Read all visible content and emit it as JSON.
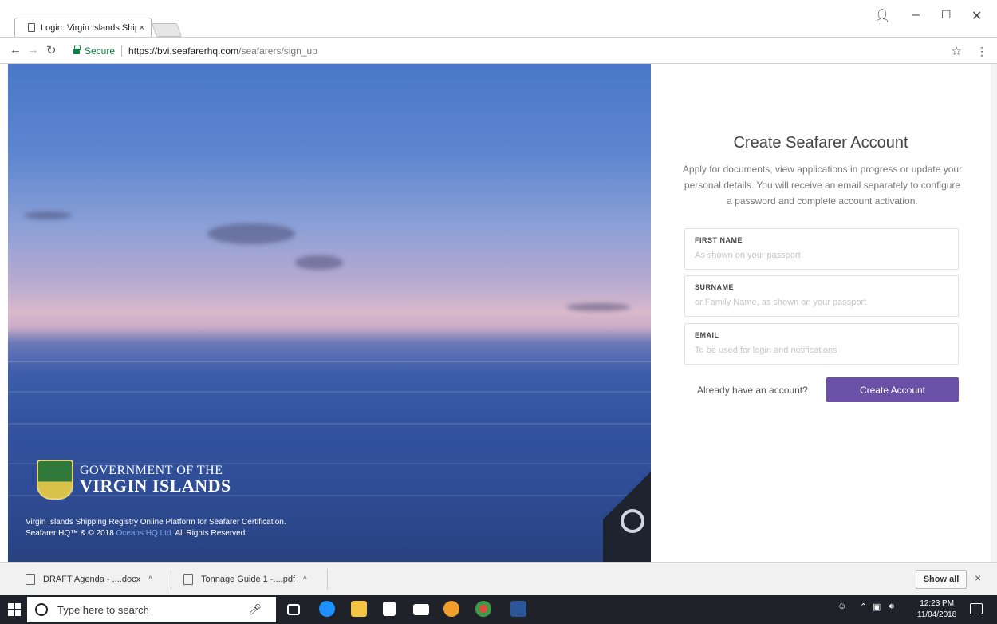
{
  "browser": {
    "tab_title": "Login: Virgin Islands Ship",
    "tab_close": "×",
    "secure_label": "Secure",
    "url_host": "https://bvi.seafarerhq.com",
    "url_path": "/seafarers/sign_up"
  },
  "hero": {
    "gov_line1": "GOVERNMENT OF THE",
    "gov_line2": "VIRGIN ISLANDS",
    "footer_line1": "Virgin Islands Shipping Registry Online Platform for Seafarer Certification.",
    "footer_line2_pre": "Seafarer HQ™ & © 2018 ",
    "footer_line2_link": "Oceans HQ Ltd.",
    "footer_line2_post": " All Rights Reserved."
  },
  "form": {
    "heading": "Create Seafarer Account",
    "description": "Apply for documents, view applications in progress or update your personal details. You will receive an email separately to configure a password and complete account activation.",
    "fields": [
      {
        "label": "FIRST NAME",
        "placeholder": "As shown on your passport",
        "value": ""
      },
      {
        "label": "SURNAME",
        "placeholder": "or Family Name, as shown on your passport",
        "value": ""
      },
      {
        "label": "EMAIL",
        "placeholder": "To be used for login and notifications",
        "value": ""
      }
    ],
    "signin_prompt": "Already have an account?",
    "submit_label": "Create Account"
  },
  "downloads": {
    "items": [
      {
        "name": "DRAFT Agenda - ....docx",
        "caret": "^"
      },
      {
        "name": "Tonnage Guide 1 -....pdf",
        "caret": "^"
      }
    ],
    "show_all": "Show all",
    "close": "×"
  },
  "taskbar": {
    "search_placeholder": "Type here to search",
    "time": "12:23 PM",
    "date": "11/04/2018"
  },
  "colors": {
    "accent": "#6a50a7",
    "secure_green": "#0b8043"
  }
}
